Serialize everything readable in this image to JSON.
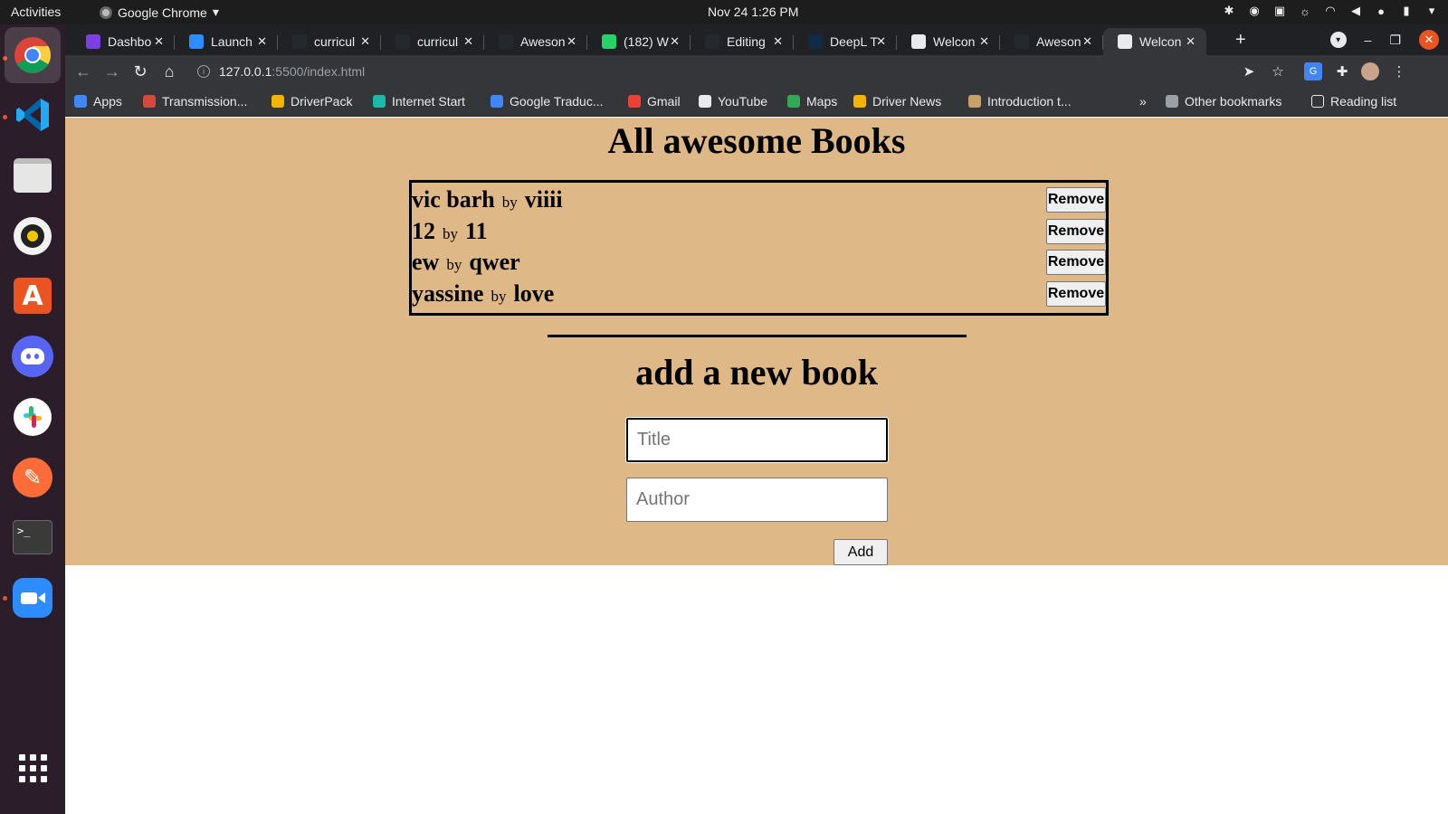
{
  "system": {
    "activities": "Activities",
    "app_menu": "Google Chrome",
    "clock": "Nov 24  1:26 PM"
  },
  "dock": {
    "apps": [
      "Google Chrome",
      "Visual Studio Code",
      "Files",
      "Rhythmbox",
      "Ubuntu Software",
      "Discord",
      "Slack",
      "Postman",
      "Terminal",
      "Zoom",
      "Show Applications"
    ]
  },
  "browser": {
    "tabs": [
      {
        "label": "Dashbo",
        "color": "#7b3fe4"
      },
      {
        "label": "Launch",
        "color": "#2d8cff"
      },
      {
        "label": "curricul",
        "color": "#24292e"
      },
      {
        "label": "curricul",
        "color": "#24292e"
      },
      {
        "label": "Aweson",
        "color": "#24292e"
      },
      {
        "label": "(182) W",
        "color": "#25d366"
      },
      {
        "label": "Editing",
        "color": "#24292e"
      },
      {
        "label": "DeepL T",
        "color": "#0f2b46"
      },
      {
        "label": "Welcon",
        "color": "#e8eaed"
      },
      {
        "label": "Aweson",
        "color": "#24292e"
      },
      {
        "label": "Welcon",
        "color": "#e8eaed"
      }
    ],
    "active_tab_index": 10,
    "url_host": "127.0.0.1",
    "url_path": ":5500/index.html",
    "bookmarks": [
      {
        "label": "Apps",
        "color": "#4285f4"
      },
      {
        "label": "Transmission...",
        "color": "#d44a3a"
      },
      {
        "label": "DriverPack",
        "color": "#f4b400"
      },
      {
        "label": "Internet Start",
        "color": "#1db9a6"
      },
      {
        "label": "Google Traduc...",
        "color": "#4285f4"
      },
      {
        "label": "Gmail",
        "color": "#ea4335"
      },
      {
        "label": "YouTube",
        "color": "#e8eaed"
      },
      {
        "label": "Maps",
        "color": "#34a853"
      },
      {
        "label": "Driver News",
        "color": "#f4b400"
      },
      {
        "label": "Introduction t...",
        "color": "#c8a06a"
      }
    ],
    "overflow": "»",
    "other_bookmarks": "Other bookmarks",
    "reading_list": "Reading list"
  },
  "page": {
    "title": "All awesome Books",
    "by_label": "by",
    "remove_label": "Remove",
    "books": [
      {
        "title": "vic barh",
        "author": "viiii"
      },
      {
        "title": "12",
        "author": "11"
      },
      {
        "title": "ew",
        "author": "qwer"
      },
      {
        "title": "yassine",
        "author": "love"
      }
    ],
    "form_title": "add a new book",
    "title_placeholder": "Title",
    "author_placeholder": "Author",
    "add_label": "Add",
    "colors": {
      "background": "#deb887"
    }
  }
}
